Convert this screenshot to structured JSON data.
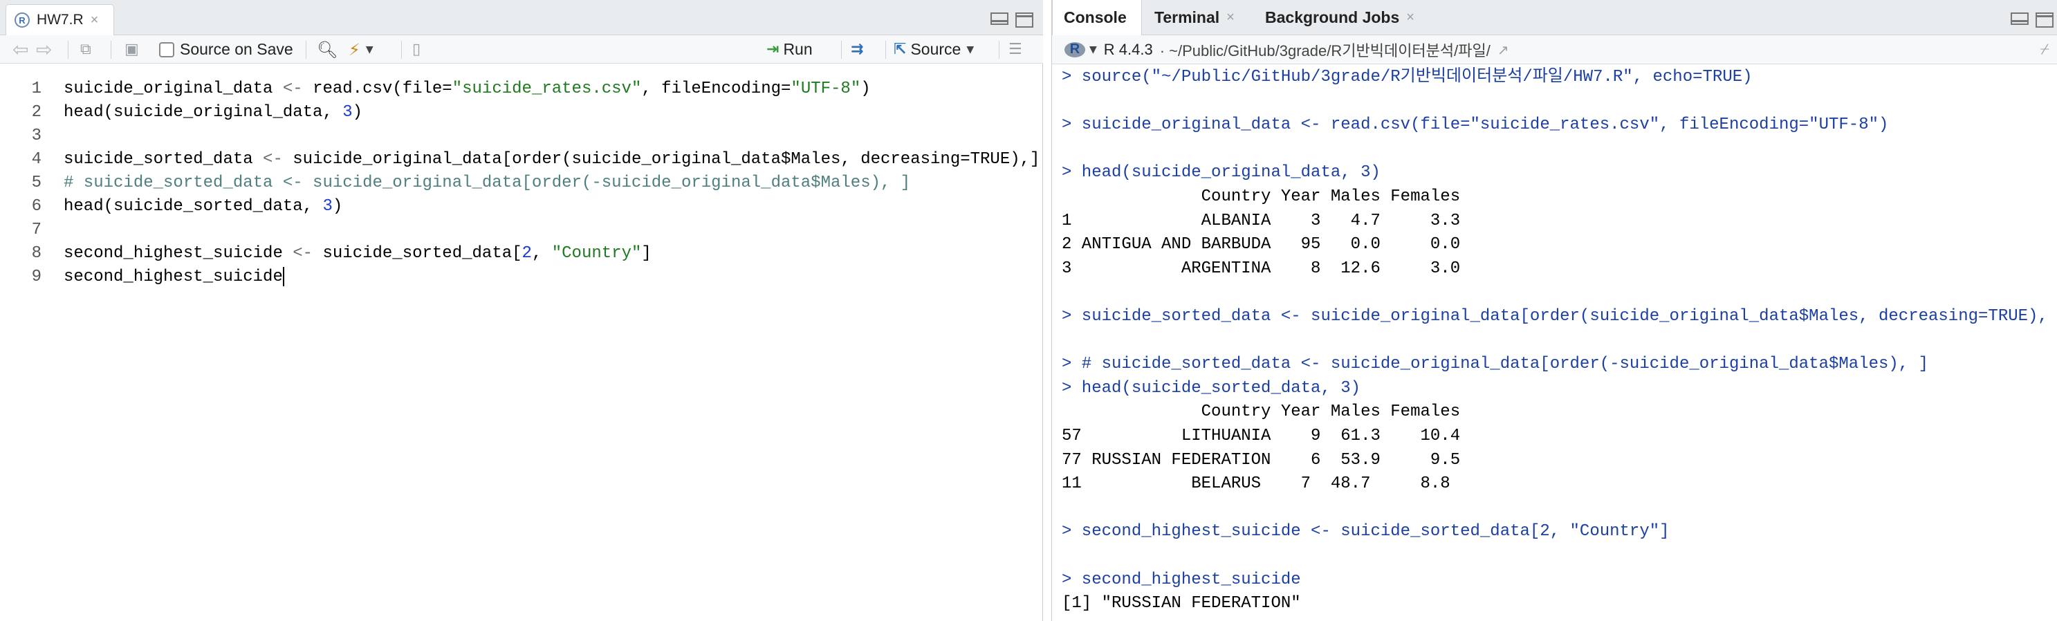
{
  "editor": {
    "tab_label": "HW7.R",
    "tab_icon": "r-file-icon",
    "toolbar": {
      "source_on_save_label": "Source on Save",
      "run_label": "Run",
      "source_label": "Source"
    },
    "line_numbers": [
      "1",
      "2",
      "3",
      "4",
      "5",
      "6",
      "7",
      "8",
      "9"
    ],
    "lines": [
      "suicide_original_data <- read.csv(file=\"suicide_rates.csv\", fileEncoding=\"UTF-8\")",
      "head(suicide_original_data, 3)",
      "",
      "suicide_sorted_data <- suicide_original_data[order(suicide_original_data$Males, decreasing=TRUE),]",
      "# suicide_sorted_data <- suicide_original_data[order(-suicide_original_data$Males), ]",
      "head(suicide_sorted_data, 3)",
      "",
      "second_highest_suicide <- suicide_sorted_data[2, \"Country\"]",
      "second_highest_suicide"
    ]
  },
  "console": {
    "tabs": [
      {
        "label": "Console",
        "active": true
      },
      {
        "label": "Terminal",
        "active": false
      },
      {
        "label": "Background Jobs",
        "active": false
      }
    ],
    "r_version": "R 4.4.3",
    "path": "· ~/Public/GitHub/3grade/R기반빅데이터분석/파일/",
    "output": [
      "> source(\"~/Public/GitHub/3grade/R기반빅데이터분석/파일/HW7.R\", echo=TRUE)",
      "",
      "> suicide_original_data <- read.csv(file=\"suicide_rates.csv\", fileEncoding=\"UTF-8\")",
      "",
      "> head(suicide_original_data, 3)",
      "              Country Year Males Females",
      "1             ALBANIA    3   4.7     3.3",
      "2 ANTIGUA AND BARBUDA   95   0.0     0.0",
      "3           ARGENTINA    8  12.6     3.0",
      "",
      "> suicide_sorted_data <- suicide_original_data[order(suicide_original_data$Males, decreasing=TRUE),",
      "",
      "> # suicide_sorted_data <- suicide_original_data[order(-suicide_original_data$Males), ]",
      "> head(suicide_sorted_data, 3)",
      "              Country Year Males Females",
      "57          LITHUANIA    9  61.3    10.4",
      "77 RUSSIAN FEDERATION    6  53.9     9.5",
      "11           BELARUS    7  48.7     8.8",
      "",
      "> second_highest_suicide <- suicide_sorted_data[2, \"Country\"]",
      "",
      "> second_highest_suicide",
      "[1] \"RUSSIAN FEDERATION\""
    ]
  }
}
